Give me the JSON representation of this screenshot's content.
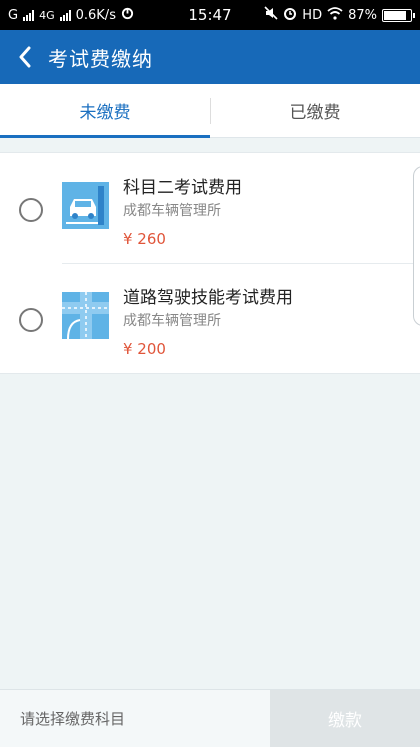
{
  "status_bar": {
    "carrier_left": "G",
    "network": "4G",
    "speed": "0.6K/s",
    "time": "15:47",
    "hd": "HD",
    "battery": "87%",
    "battery_level": 0.87
  },
  "header": {
    "title": "考试费缴纳",
    "back_icon": "chevron-left-icon"
  },
  "tabs": [
    {
      "label": "未缴费",
      "active": true
    },
    {
      "label": "已缴费",
      "active": false
    }
  ],
  "items": [
    {
      "title": "科目二考试费用",
      "org": "成都车辆管理所",
      "price": "¥ 260",
      "icon": "car-parking-icon"
    },
    {
      "title": "道路驾驶技能考试费用",
      "org": "成都车辆管理所",
      "price": "¥ 200",
      "icon": "road-map-icon"
    }
  ],
  "bottom": {
    "hint": "请选择缴费科目",
    "pay_label": "缴款"
  },
  "colors": {
    "header": "#1769b8",
    "accent": "#1a6fc0",
    "price": "#e0553a",
    "pay_disabled": "#dfe4e6"
  }
}
